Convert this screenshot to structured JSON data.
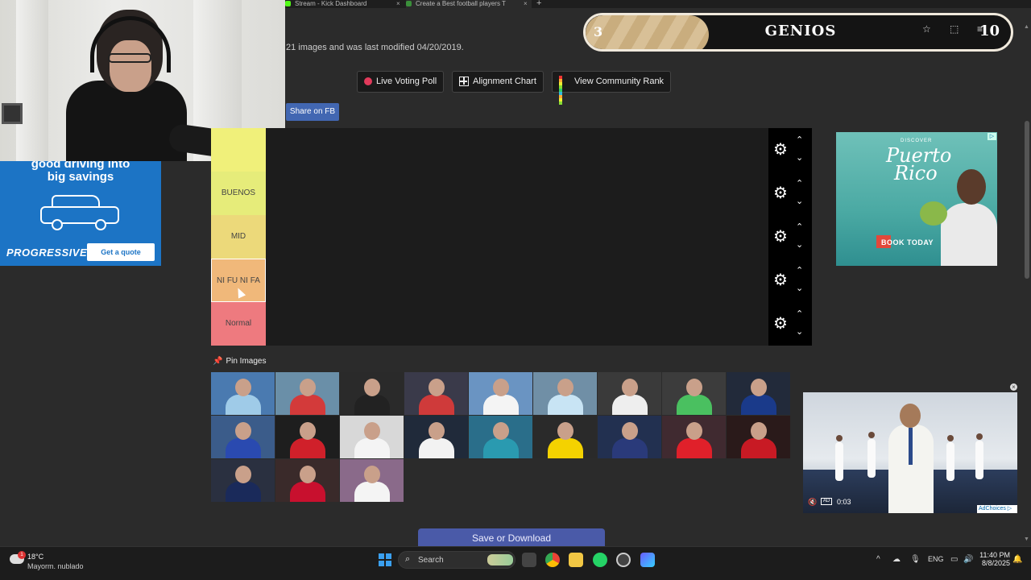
{
  "browser": {
    "tabs": [
      {
        "title": "Stream - Kick Dashboard",
        "icon_color": "#53fc18"
      },
      {
        "title": "Create a Best football players T",
        "icon_color": "#3a8f3a"
      }
    ],
    "new_tab": "+",
    "close_glyph": "×"
  },
  "page": {
    "meta_text": "21 images and was last modified 04/20/2019.",
    "buttons": {
      "live_voting": "Live Voting Poll",
      "alignment": "Alignment Chart",
      "community": "View Community Rank",
      "share_fb": "Share on FB"
    },
    "tiers": [
      {
        "label": "",
        "color": "#f0f07a"
      },
      {
        "label": "BUENOS",
        "color": "#e6ec7a"
      },
      {
        "label": "MID",
        "color": "#ecd97a"
      },
      {
        "label": "NI FU NI FA",
        "color": "#f0b87a"
      },
      {
        "label": "Normal",
        "color": "#ee7a7f"
      }
    ],
    "tier_controls": {
      "gear": "⚙",
      "up": "⌃",
      "down": "⌄"
    },
    "pin_title": "Pin Images",
    "pin_icon": "📌",
    "players": [
      {
        "bg": "#4a7ab0",
        "kit": "#9fcbe8"
      },
      {
        "bg": "#6a8fa8",
        "kit": "#d33a3a"
      },
      {
        "bg": "#2a2a2a",
        "kit": "#222"
      },
      {
        "bg": "#3a3a4a",
        "kit": "#cf3a3a"
      },
      {
        "bg": "#6a94c2",
        "kit": "#f4f4f4"
      },
      {
        "bg": "#708fa6",
        "kit": "#c8e4f4"
      },
      {
        "bg": "#3a3a3a",
        "kit": "#eee"
      },
      {
        "bg": "#3c3c3c",
        "kit": "#4ac060"
      },
      {
        "bg": "#222a3a",
        "kit": "#1a3a8a"
      },
      {
        "bg": "#3b5c8a",
        "kit": "#2a4ab0"
      },
      {
        "bg": "#1e1e1e",
        "kit": "#d0202a"
      },
      {
        "bg": "#d8d8d8",
        "kit": "#f4f4f4"
      },
      {
        "bg": "#202a3a",
        "kit": "#f2f2f2"
      },
      {
        "bg": "#2a6e8a",
        "kit": "#2a9ab0"
      },
      {
        "bg": "#2a2a2a",
        "kit": "#f4d200"
      },
      {
        "bg": "#223050",
        "kit": "#2a3a7a"
      },
      {
        "bg": "#402a30",
        "kit": "#e0202a"
      },
      {
        "bg": "#2a1a1a",
        "kit": "#c81a24"
      },
      {
        "bg": "#2a3040",
        "kit": "#1a2a5a"
      },
      {
        "bg": "#3a2a2a",
        "kit": "#c8102e"
      },
      {
        "bg": "#8a6a8a",
        "kit": "#f4f4f4"
      }
    ],
    "save_button": "Save or Download"
  },
  "overlay": {
    "left_number": "3",
    "title": "GENIOS",
    "right_number": "10",
    "progress": 0.29
  },
  "ads": {
    "left": {
      "headline_line1": "good driving into",
      "headline_line2": "big savings",
      "brand": "PROGRESSIVE",
      "cta": "Get a quote"
    },
    "right": {
      "discover": "DISCOVER",
      "destination_line1": "Puerto",
      "destination_line2": "Rico",
      "cta": "BOOK TODAY",
      "adchoice": "▷"
    },
    "video": {
      "mute": "🔇",
      "ad_tag": "AD",
      "time": "0:03",
      "adchoices": "AdChoices ▷",
      "close": "×"
    }
  },
  "taskbar": {
    "weather_temp": "18°C",
    "weather_desc": "Mayorm. nublado",
    "weather_badge": "1",
    "search_label": "Search",
    "search_icon": "⌕",
    "lang": "ENG",
    "time": "11:40 PM",
    "date": "8/8/2025",
    "chevron": "^"
  }
}
